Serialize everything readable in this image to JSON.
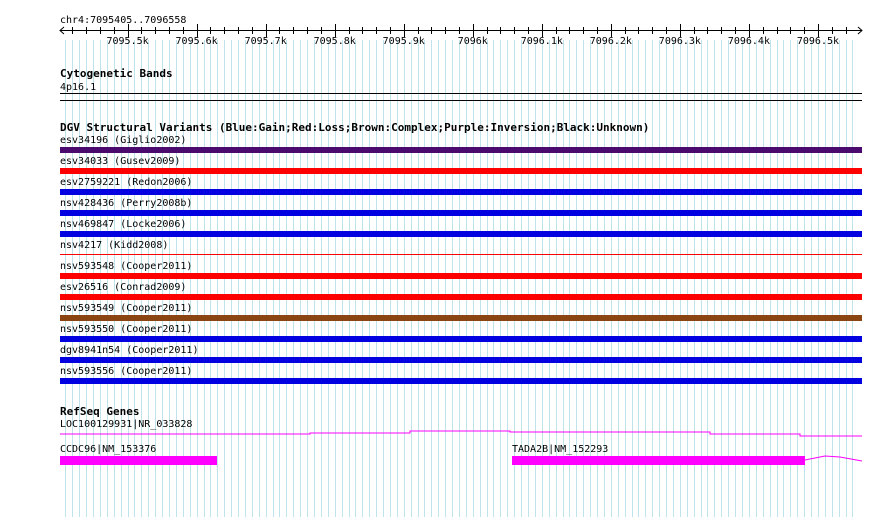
{
  "ruler": {
    "position_label": "chr4:7095405..7096558",
    "start": 7095405,
    "end": 7096558,
    "ticks": [
      {
        "value": 7095500,
        "label": "7095.5k"
      },
      {
        "value": 7095600,
        "label": "7095.6k"
      },
      {
        "value": 7095700,
        "label": "7095.7k"
      },
      {
        "value": 7095800,
        "label": "7095.8k"
      },
      {
        "value": 7095900,
        "label": "7095.9k"
      },
      {
        "value": 7096000,
        "label": "7096k"
      },
      {
        "value": 7096100,
        "label": "7096.1k"
      },
      {
        "value": 7096200,
        "label": "7096.2k"
      },
      {
        "value": 7096300,
        "label": "7096.3k"
      },
      {
        "value": 7096400,
        "label": "7096.4k"
      },
      {
        "value": 7096500,
        "label": "7096.5k"
      }
    ]
  },
  "cytoband": {
    "title": "Cytogenetic Bands",
    "band": "4p16.1"
  },
  "dgv": {
    "title": "DGV Structural Variants (Blue:Gain;Red:Loss;Brown:Complex;Purple:Inversion;Black:Unknown)",
    "variants": [
      {
        "label": "esv34196 (Giglio2002)",
        "color": "#4b0a6e",
        "style": "thick"
      },
      {
        "label": "esv34033 (Gusev2009)",
        "color": "#ff0000",
        "style": "thick"
      },
      {
        "label": "esv2759221 (Redon2006)",
        "color": "#0000e0",
        "style": "thick"
      },
      {
        "label": "nsv428436 (Perry2008b)",
        "color": "#0000e0",
        "style": "thick"
      },
      {
        "label": "nsv469847 (Locke2006)",
        "color": "#0000e0",
        "style": "thick"
      },
      {
        "label": "nsv4217 (Kidd2008)",
        "color": "#ff0000",
        "style": "thin"
      },
      {
        "label": "nsv593548 (Cooper2011)",
        "color": "#ff0000",
        "style": "thick"
      },
      {
        "label": "esv26516 (Conrad2009)",
        "color": "#ff0000",
        "style": "thick"
      },
      {
        "label": "nsv593549 (Cooper2011)",
        "color": "#8b4513",
        "style": "thick"
      },
      {
        "label": "nsv593550 (Cooper2011)",
        "color": "#0000e0",
        "style": "thick"
      },
      {
        "label": "dgv8941n54 (Cooper2011)",
        "color": "#0000e0",
        "style": "thick"
      },
      {
        "label": "nsv593556 (Cooper2011)",
        "color": "#0000e0",
        "style": "thick"
      }
    ]
  },
  "refseq": {
    "title": "RefSeq Genes",
    "gene_color": "#ff00ff",
    "genes": [
      {
        "label": "LOC100129931|NR_033828"
      },
      {
        "label": "CCDC96|NM_153376"
      },
      {
        "label": "TADA2B|NM_152293"
      }
    ]
  }
}
